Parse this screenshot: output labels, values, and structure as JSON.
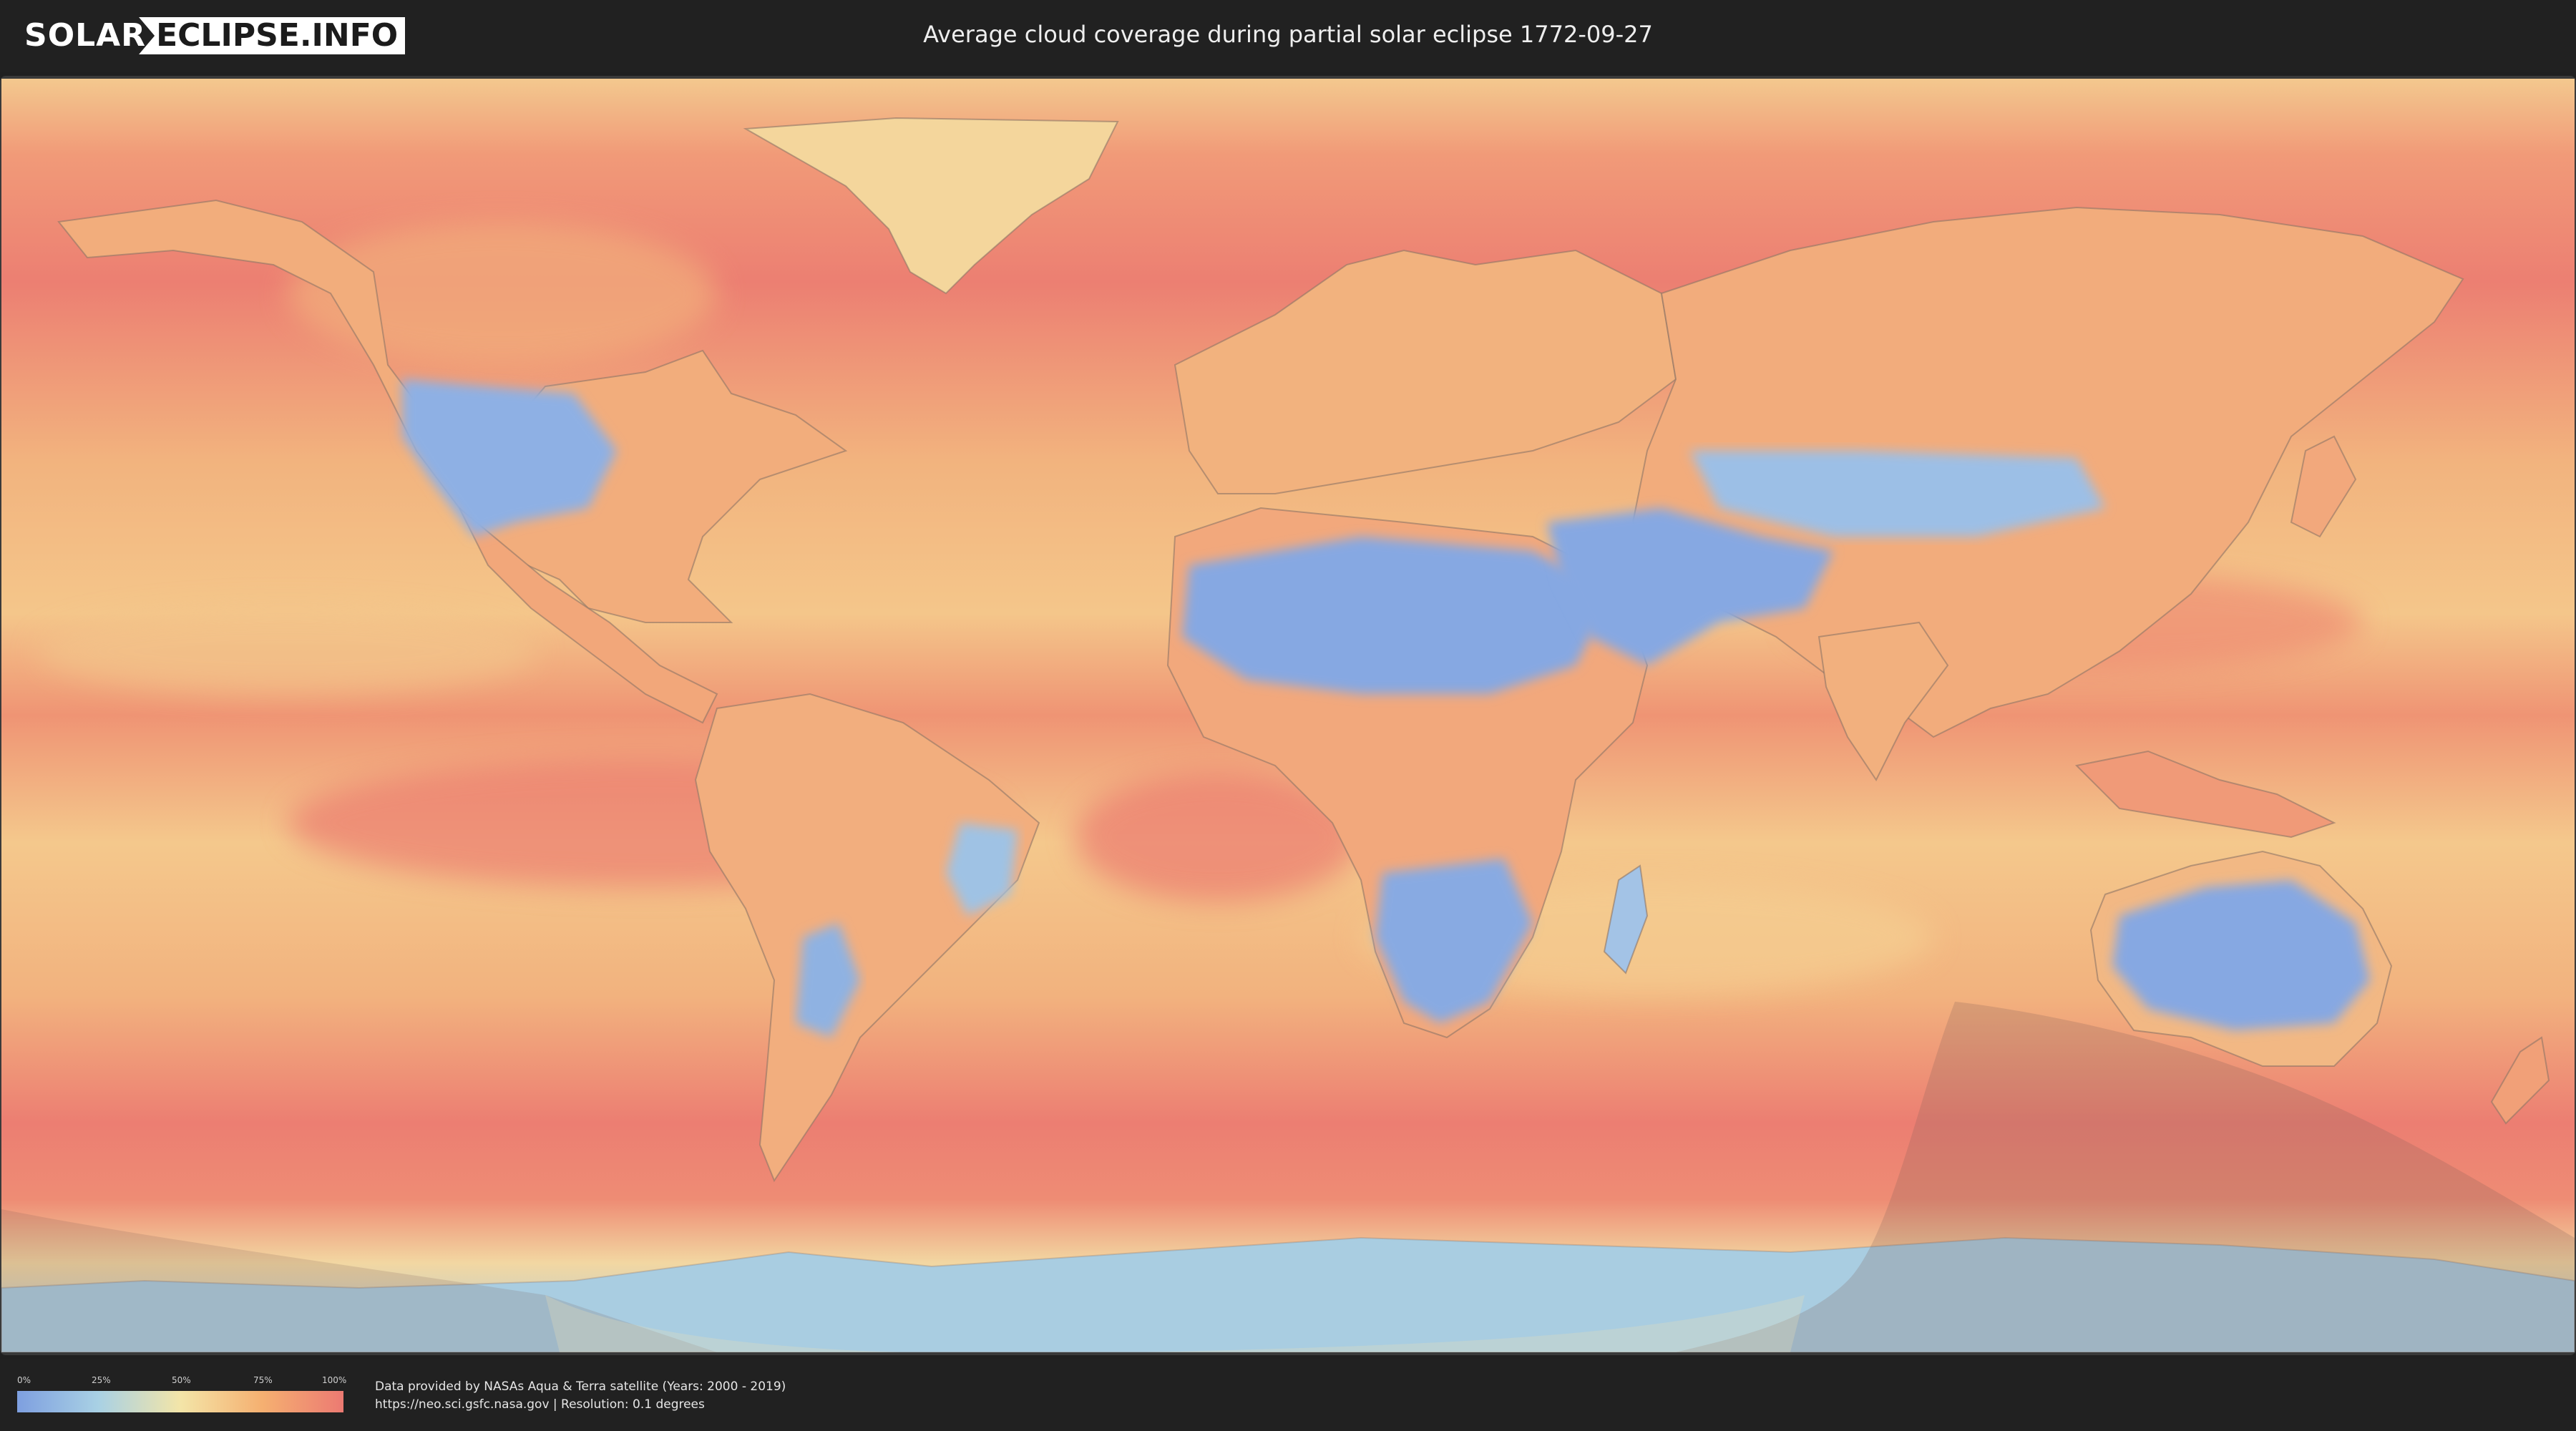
{
  "header": {
    "logo_left": "SOLAR",
    "logo_right": "ECLIPSE.INFO",
    "title": "Average cloud coverage during partial solar eclipse 1772-09-27"
  },
  "legend": {
    "ticks": [
      "0%",
      "25%",
      "50%",
      "75%",
      "100%"
    ],
    "gradient_colors": [
      "#7e9fe0",
      "#a9d1e4",
      "#f3e5a8",
      "#f5b071",
      "#ec7a72"
    ]
  },
  "footer": {
    "credit_line_1": "Data provided by NASAs Aqua & Terra satellite (Years: 2000 - 2019)",
    "credit_line_2": "https://neo.sci.gsfc.nasa.gov | Resolution: 0.1 degrees"
  },
  "map": {
    "ocean_color": "#f2a678",
    "high_cloud_color": "#ec7c72",
    "low_cloud_color": "#86a8e2",
    "eclipse_shade_color": "#8a6a60"
  }
}
